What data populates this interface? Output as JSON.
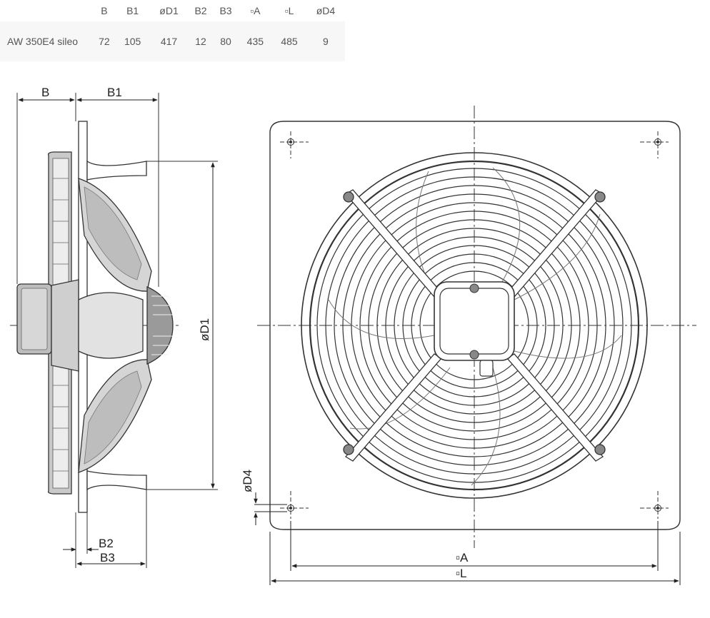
{
  "table": {
    "headers": [
      "",
      "B",
      "B1",
      "øD1",
      "B2",
      "B3",
      "▫A",
      "▫L",
      "øD4"
    ],
    "rows": [
      [
        "AW 350E4 sileo",
        "72",
        "105",
        "417",
        "12",
        "80",
        "435",
        "485",
        "9"
      ]
    ]
  },
  "drawing": {
    "labels": {
      "B": "B",
      "B1": "B1",
      "D1": "øD1",
      "B2": "B2",
      "B3": "B3",
      "A": "▫A",
      "L": "▫L",
      "D4": "øD4"
    }
  }
}
